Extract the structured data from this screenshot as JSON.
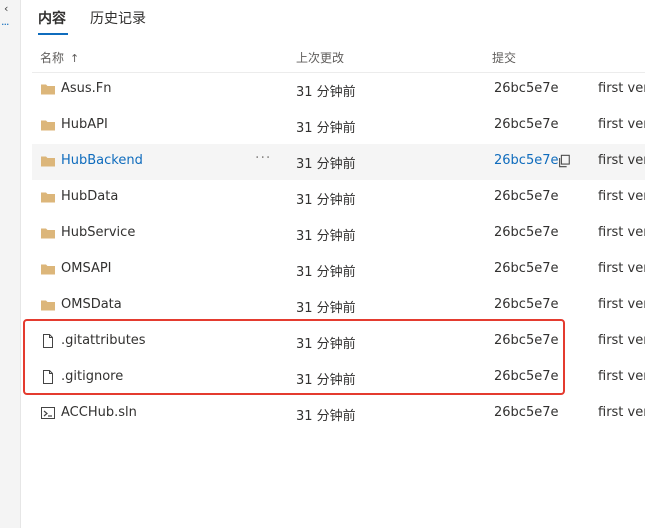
{
  "tabs": [
    {
      "label": "内容",
      "selected": true
    },
    {
      "label": "历史记录",
      "selected": false
    }
  ],
  "columns": {
    "name": "名称",
    "sort_indicator": "↑",
    "last_changed": "上次更改",
    "commit": "提交"
  },
  "rows": [
    {
      "name": "Asus.Fn",
      "type": "folder",
      "time": "31 分钟前",
      "commit": "26bc5e7e",
      "message": "first ver"
    },
    {
      "name": "HubAPI",
      "type": "folder",
      "time": "31 分钟前",
      "commit": "26bc5e7e",
      "message": "first ver"
    },
    {
      "name": "HubBackend",
      "type": "folder",
      "time": "31 分钟前",
      "commit": "26bc5e7e",
      "message": "first ver",
      "more": "···"
    },
    {
      "name": "HubData",
      "type": "folder",
      "time": "31 分钟前",
      "commit": "26bc5e7e",
      "message": "first ver"
    },
    {
      "name": "HubService",
      "type": "folder",
      "time": "31 分钟前",
      "commit": "26bc5e7e",
      "message": "first ver"
    },
    {
      "name": "OMSAPI",
      "type": "folder",
      "time": "31 分钟前",
      "commit": "26bc5e7e",
      "message": "first ver"
    },
    {
      "name": "OMSData",
      "type": "folder",
      "time": "31 分钟前",
      "commit": "26bc5e7e",
      "message": "first ver"
    },
    {
      "name": ".gitattributes",
      "type": "file",
      "time": "31 分钟前",
      "commit": "26bc5e7e",
      "message": "first ver"
    },
    {
      "name": ".gitignore",
      "type": "file",
      "time": "31 分钟前",
      "commit": "26bc5e7e",
      "message": "first ver"
    },
    {
      "name": "ACCHub.sln",
      "type": "solution",
      "time": "31 分钟前",
      "commit": "26bc5e7e",
      "message": "first ver"
    }
  ],
  "colors": {
    "accent": "#0f6cbd",
    "folder": "#dcb67a",
    "highlight": "#e43b2f"
  },
  "icons": {
    "folder": "folder-icon",
    "file": "file-icon",
    "solution": "solution-file-icon",
    "copy": "copy-icon",
    "sidebar_chevron": "chevron-left-icon",
    "sidebar_more": "more-icon"
  }
}
